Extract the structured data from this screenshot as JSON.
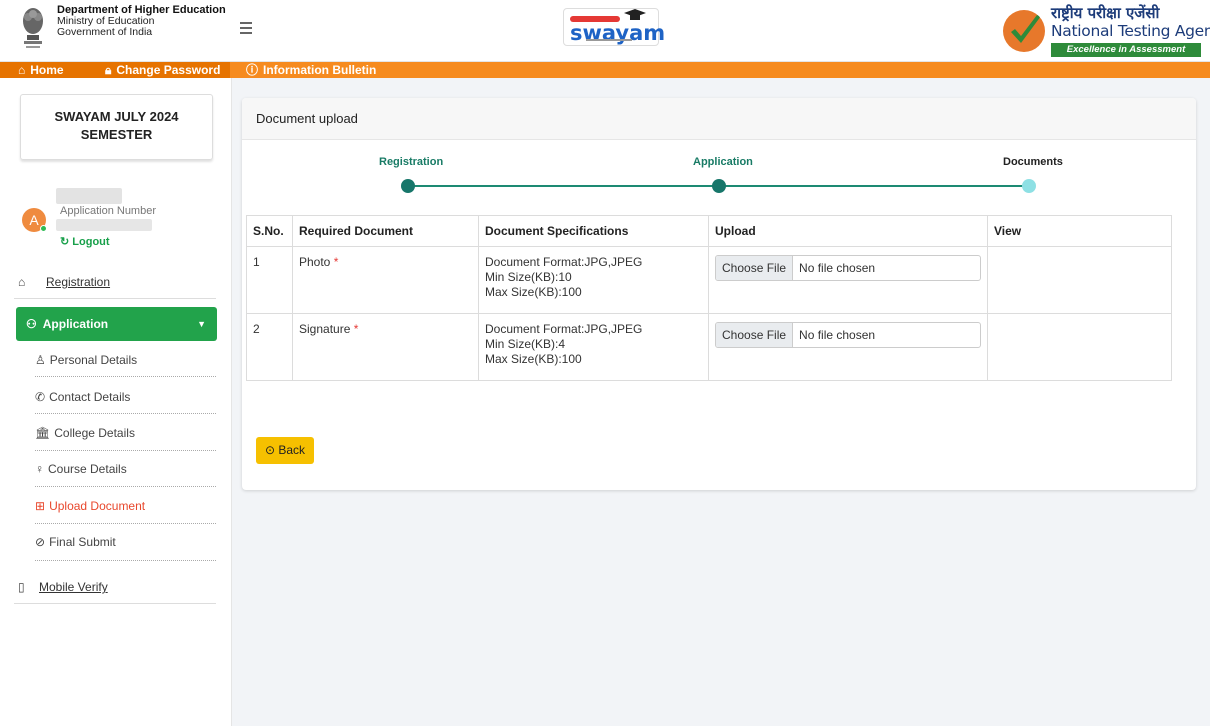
{
  "header": {
    "dept_line1": "Department of Higher Education",
    "dept_line2": "Ministry of Education",
    "dept_line3": "Government of India",
    "swayam_logo": "swayam",
    "nta_hindi": "राष्ट्रीय परीक्षा एजेंसी",
    "nta_english": "National Testing Agency",
    "nta_slogan": "Excellence in Assessment"
  },
  "nav": {
    "home": "Home",
    "change_password": "Change Password",
    "information_bulletin": "Information Bulletin"
  },
  "sidebar": {
    "semester_title": "SWAYAM JULY 2024 SEMESTER",
    "avatar_initial": "A",
    "application_number_label": "Application Number",
    "logout": "Logout",
    "registration": "Registration",
    "application": "Application",
    "sub_items": [
      "Personal Details",
      "Contact Details",
      "College Details",
      "Course Details",
      "Upload Document",
      "Final Submit"
    ],
    "mobile_verify": "Mobile Verify"
  },
  "main": {
    "card_title": "Document upload",
    "steps": [
      "Registration",
      "Application",
      "Documents"
    ],
    "table": {
      "headers": [
        "S.No.",
        "Required Document",
        "Document Specifications",
        "Upload",
        "View"
      ],
      "rows": [
        {
          "sno": "1",
          "doc": "Photo",
          "spec1": "Document Format:JPG,JPEG",
          "spec2": "Min Size(KB):10",
          "spec3": "Max Size(KB):100"
        },
        {
          "sno": "2",
          "doc": "Signature",
          "spec1": "Document Format:JPG,JPEG",
          "spec2": "Min Size(KB):4",
          "spec3": "Max Size(KB):100"
        }
      ],
      "choose_file": "Choose File",
      "no_file": "No file chosen",
      "required_mark": "*"
    },
    "back": "Back"
  },
  "colors": {
    "accent_orange": "#f68b1f",
    "sidebar_active_green": "#22a34b",
    "stepper_teal": "#17766a",
    "back_yellow": "#f6c000",
    "upload_active_red": "#e8472c"
  }
}
